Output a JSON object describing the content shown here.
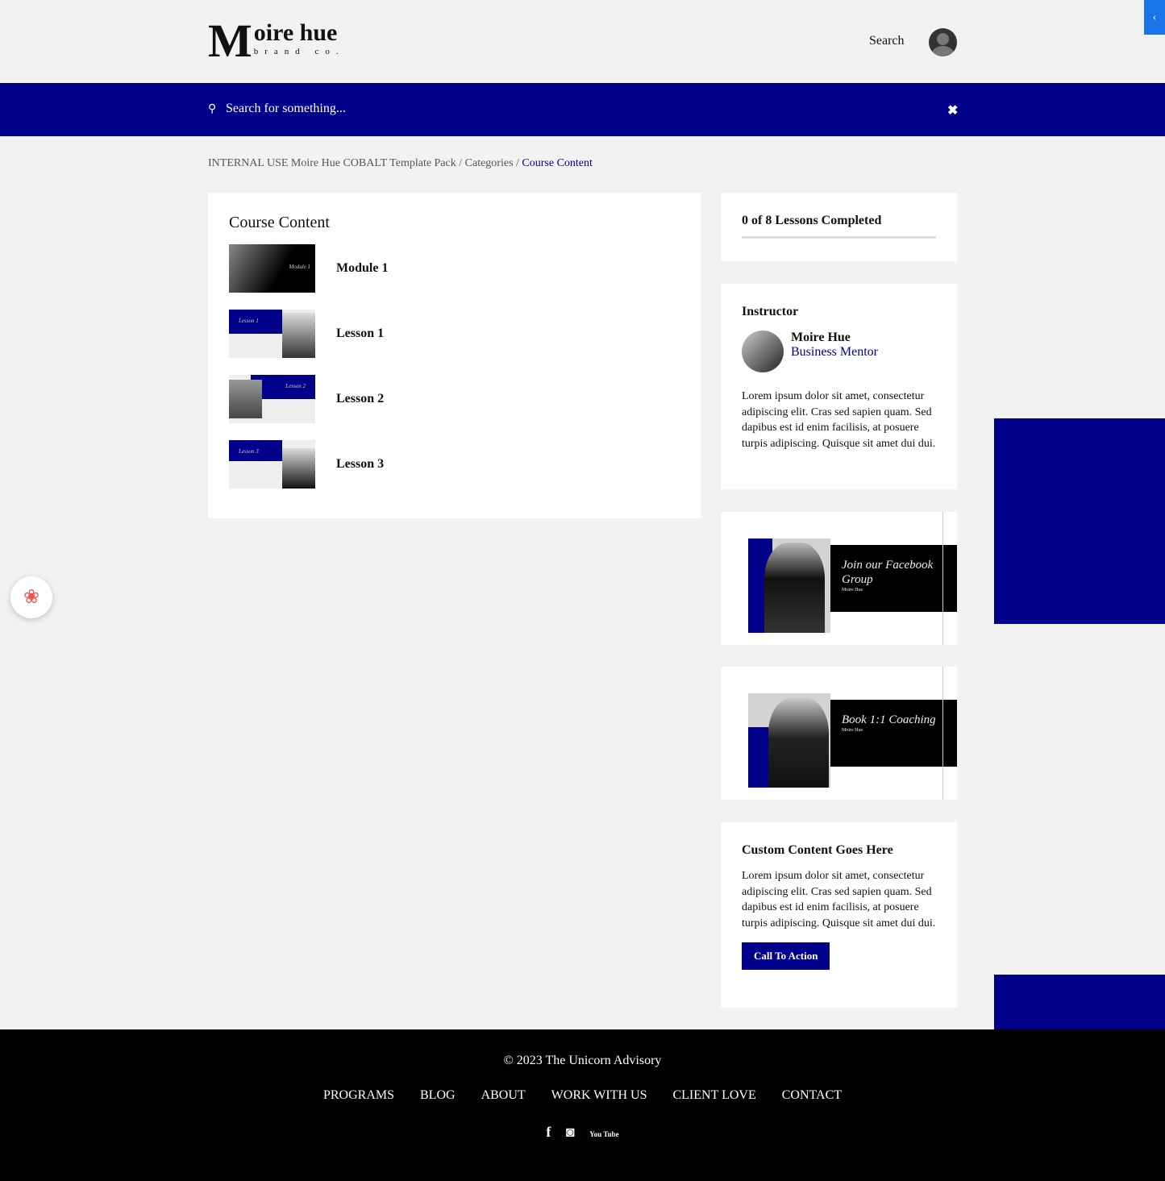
{
  "header": {
    "logo_big": "M",
    "logo_text": "oire hue",
    "logo_sub": "brand co.",
    "search_label": "Search",
    "collapse_icon": "‹"
  },
  "search_bar": {
    "placeholder": "Search for something...",
    "icon": "🔍",
    "close": "✖"
  },
  "breadcrumb": {
    "items": [
      "INTERNAL USE Moire Hue COBALT Template Pack",
      "Categories"
    ],
    "separator": "/",
    "current": "Course Content"
  },
  "course": {
    "title": "Course Content",
    "items": [
      {
        "label": "Module 1",
        "thumb_text": "Module 1"
      },
      {
        "label": "Lesson 1",
        "thumb_text": "Lesson 1"
      },
      {
        "label": "Lesson 2",
        "thumb_text": "Lesson 2"
      },
      {
        "label": "Lesson 3",
        "thumb_text": "Lesson 3"
      }
    ]
  },
  "progress": {
    "text": "0 of 8 Lessons Completed",
    "completed": 0,
    "total": 8
  },
  "instructor": {
    "heading": "Instructor",
    "name": "Moire Hue",
    "role": "Business Mentor",
    "bio": "Lorem ipsum dolor sit amet, consectetur adipiscing elit. Cras sed sapien quam. Sed dapibus est id enim facilisis, at posuere turpis adipiscing. Quisque sit amet dui dui."
  },
  "promos": [
    {
      "title": "Join our Facebook Group",
      "brand": "Moire Hue"
    },
    {
      "title": "Book 1:1 Coaching",
      "brand": "Moire Hue"
    }
  ],
  "custom": {
    "title": "Custom Content Goes Here",
    "body": "Lorem ipsum dolor sit amet, consectetur adipiscing elit. Cras sed sapien quam. Sed dapibus est id enim facilisis, at posuere turpis adipiscing. Quisque sit amet dui dui.",
    "cta": "Call To Action"
  },
  "footer": {
    "copyright": "© 2023 The Unicorn Advisory",
    "nav": [
      "PROGRAMS",
      "BLOG",
      "ABOUT",
      "WORK WITH US",
      "CLIENT LOVE",
      "CONTACT"
    ],
    "social": [
      "f",
      "◙",
      "You Tube"
    ]
  },
  "colors": {
    "brand": "#00008b",
    "footer": "#000000"
  }
}
